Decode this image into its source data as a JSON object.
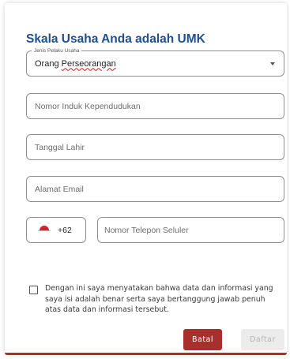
{
  "colors": {
    "title": "#1f4f8c",
    "accent": "#a8302c",
    "flag_red": "#d32330",
    "disabled_bg": "#ececec"
  },
  "form": {
    "title": "Skala Usaha Anda adalah UMK",
    "business_actor_type": {
      "legend": "Jenis Pelaku Usaha",
      "value_prefix": "Orang ",
      "value_highlight": "Perseorangan"
    },
    "nik_placeholder": "Nomor Induk Kependudukan",
    "dob_placeholder": "Tanggal Lahir",
    "email_placeholder": "Alamat Email",
    "phone": {
      "country_flag_icon": "indonesia-flag-icon",
      "country_code": "+62",
      "placeholder": "Nomor Telepon Seluler"
    },
    "consent_text": "Dengan ini saya menyatakan bahwa data dan informasi yang saya isi adalah benar serta saya bertanggung jawab penuh atas data dan informasi tersebut.",
    "consent_checked": false
  },
  "actions": {
    "cancel_label": "Batal",
    "submit_label": "Daftar"
  }
}
